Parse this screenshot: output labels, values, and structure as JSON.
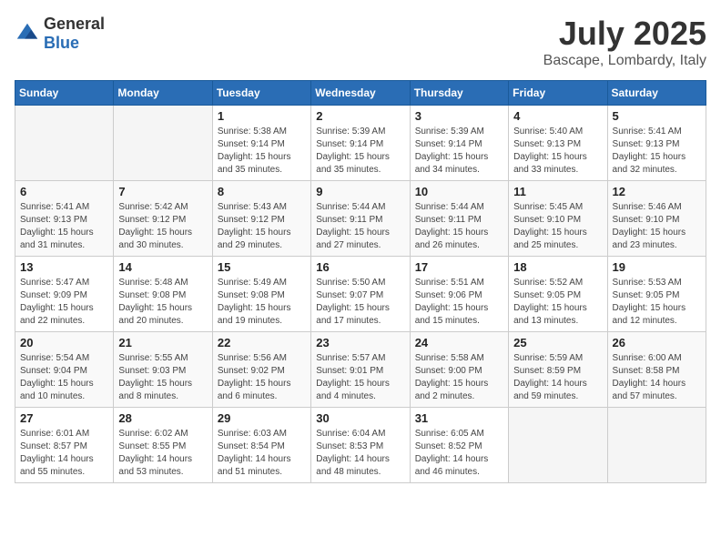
{
  "header": {
    "logo_general": "General",
    "logo_blue": "Blue",
    "month": "July 2025",
    "location": "Bascape, Lombardy, Italy"
  },
  "weekdays": [
    "Sunday",
    "Monday",
    "Tuesday",
    "Wednesday",
    "Thursday",
    "Friday",
    "Saturday"
  ],
  "weeks": [
    [
      {
        "day": "",
        "info": ""
      },
      {
        "day": "",
        "info": ""
      },
      {
        "day": "1",
        "info": "Sunrise: 5:38 AM\nSunset: 9:14 PM\nDaylight: 15 hours and 35 minutes."
      },
      {
        "day": "2",
        "info": "Sunrise: 5:39 AM\nSunset: 9:14 PM\nDaylight: 15 hours and 35 minutes."
      },
      {
        "day": "3",
        "info": "Sunrise: 5:39 AM\nSunset: 9:14 PM\nDaylight: 15 hours and 34 minutes."
      },
      {
        "day": "4",
        "info": "Sunrise: 5:40 AM\nSunset: 9:13 PM\nDaylight: 15 hours and 33 minutes."
      },
      {
        "day": "5",
        "info": "Sunrise: 5:41 AM\nSunset: 9:13 PM\nDaylight: 15 hours and 32 minutes."
      }
    ],
    [
      {
        "day": "6",
        "info": "Sunrise: 5:41 AM\nSunset: 9:13 PM\nDaylight: 15 hours and 31 minutes."
      },
      {
        "day": "7",
        "info": "Sunrise: 5:42 AM\nSunset: 9:12 PM\nDaylight: 15 hours and 30 minutes."
      },
      {
        "day": "8",
        "info": "Sunrise: 5:43 AM\nSunset: 9:12 PM\nDaylight: 15 hours and 29 minutes."
      },
      {
        "day": "9",
        "info": "Sunrise: 5:44 AM\nSunset: 9:11 PM\nDaylight: 15 hours and 27 minutes."
      },
      {
        "day": "10",
        "info": "Sunrise: 5:44 AM\nSunset: 9:11 PM\nDaylight: 15 hours and 26 minutes."
      },
      {
        "day": "11",
        "info": "Sunrise: 5:45 AM\nSunset: 9:10 PM\nDaylight: 15 hours and 25 minutes."
      },
      {
        "day": "12",
        "info": "Sunrise: 5:46 AM\nSunset: 9:10 PM\nDaylight: 15 hours and 23 minutes."
      }
    ],
    [
      {
        "day": "13",
        "info": "Sunrise: 5:47 AM\nSunset: 9:09 PM\nDaylight: 15 hours and 22 minutes."
      },
      {
        "day": "14",
        "info": "Sunrise: 5:48 AM\nSunset: 9:08 PM\nDaylight: 15 hours and 20 minutes."
      },
      {
        "day": "15",
        "info": "Sunrise: 5:49 AM\nSunset: 9:08 PM\nDaylight: 15 hours and 19 minutes."
      },
      {
        "day": "16",
        "info": "Sunrise: 5:50 AM\nSunset: 9:07 PM\nDaylight: 15 hours and 17 minutes."
      },
      {
        "day": "17",
        "info": "Sunrise: 5:51 AM\nSunset: 9:06 PM\nDaylight: 15 hours and 15 minutes."
      },
      {
        "day": "18",
        "info": "Sunrise: 5:52 AM\nSunset: 9:05 PM\nDaylight: 15 hours and 13 minutes."
      },
      {
        "day": "19",
        "info": "Sunrise: 5:53 AM\nSunset: 9:05 PM\nDaylight: 15 hours and 12 minutes."
      }
    ],
    [
      {
        "day": "20",
        "info": "Sunrise: 5:54 AM\nSunset: 9:04 PM\nDaylight: 15 hours and 10 minutes."
      },
      {
        "day": "21",
        "info": "Sunrise: 5:55 AM\nSunset: 9:03 PM\nDaylight: 15 hours and 8 minutes."
      },
      {
        "day": "22",
        "info": "Sunrise: 5:56 AM\nSunset: 9:02 PM\nDaylight: 15 hours and 6 minutes."
      },
      {
        "day": "23",
        "info": "Sunrise: 5:57 AM\nSunset: 9:01 PM\nDaylight: 15 hours and 4 minutes."
      },
      {
        "day": "24",
        "info": "Sunrise: 5:58 AM\nSunset: 9:00 PM\nDaylight: 15 hours and 2 minutes."
      },
      {
        "day": "25",
        "info": "Sunrise: 5:59 AM\nSunset: 8:59 PM\nDaylight: 14 hours and 59 minutes."
      },
      {
        "day": "26",
        "info": "Sunrise: 6:00 AM\nSunset: 8:58 PM\nDaylight: 14 hours and 57 minutes."
      }
    ],
    [
      {
        "day": "27",
        "info": "Sunrise: 6:01 AM\nSunset: 8:57 PM\nDaylight: 14 hours and 55 minutes."
      },
      {
        "day": "28",
        "info": "Sunrise: 6:02 AM\nSunset: 8:55 PM\nDaylight: 14 hours and 53 minutes."
      },
      {
        "day": "29",
        "info": "Sunrise: 6:03 AM\nSunset: 8:54 PM\nDaylight: 14 hours and 51 minutes."
      },
      {
        "day": "30",
        "info": "Sunrise: 6:04 AM\nSunset: 8:53 PM\nDaylight: 14 hours and 48 minutes."
      },
      {
        "day": "31",
        "info": "Sunrise: 6:05 AM\nSunset: 8:52 PM\nDaylight: 14 hours and 46 minutes."
      },
      {
        "day": "",
        "info": ""
      },
      {
        "day": "",
        "info": ""
      }
    ]
  ]
}
